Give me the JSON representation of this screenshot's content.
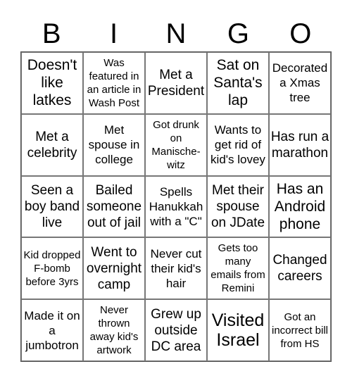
{
  "title_letters": [
    "B",
    "I",
    "N",
    "G",
    "O"
  ],
  "cells": [
    {
      "text": "Doesn't like latkes"
    },
    {
      "text": "Was featured in an article in Wash Post"
    },
    {
      "text": "Met a President"
    },
    {
      "text": "Sat on Santa's lap"
    },
    {
      "text": "Decorated a Xmas tree"
    },
    {
      "text": "Met a celebrity"
    },
    {
      "text": "Met spouse in college"
    },
    {
      "text": "Got drunk on Manische-witz"
    },
    {
      "text": "Wants to get rid of kid's lovey"
    },
    {
      "text": "Has run a marathon"
    },
    {
      "text": "Seen a boy band live"
    },
    {
      "text": "Bailed someone out of jail"
    },
    {
      "text": "Spells Hanukkah with a \"C\""
    },
    {
      "text": "Met their spouse on JDate"
    },
    {
      "text": "Has an Android phone"
    },
    {
      "text": "Kid dropped F-bomb before 3yrs"
    },
    {
      "text": "Went to overnight camp"
    },
    {
      "text": "Never cut their kid's hair"
    },
    {
      "text": "Gets too many emails from Remini"
    },
    {
      "text": "Changed careers"
    },
    {
      "text": "Made it on a jumbotron"
    },
    {
      "text": "Never thrown away kid's artwork"
    },
    {
      "text": "Grew up outside DC area"
    },
    {
      "text": "Visited Israel"
    },
    {
      "text": "Got an incorrect bill from HS"
    }
  ]
}
